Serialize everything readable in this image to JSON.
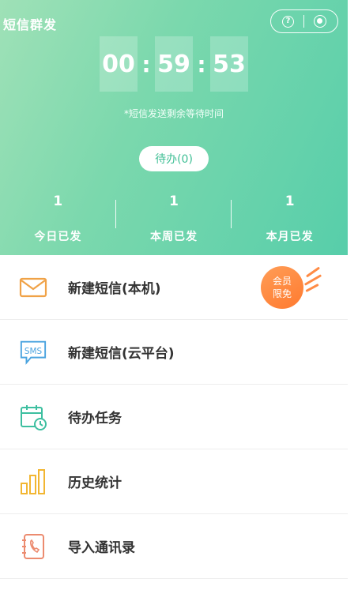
{
  "header": {
    "title": "短信群发"
  },
  "timer": {
    "hours": "00",
    "minutes": "59",
    "seconds": "53",
    "note": "*短信发送剩余等待时间"
  },
  "pending_button": "待办(0)",
  "stats": [
    {
      "value": "1",
      "label": "今日已发"
    },
    {
      "value": "1",
      "label": "本周已发"
    },
    {
      "value": "1",
      "label": "本月已发"
    }
  ],
  "vip_badge": {
    "line1": "会员",
    "line2": "限免"
  },
  "menu": [
    {
      "label": "新建短信(本机)",
      "icon": "envelope-icon"
    },
    {
      "label": "新建短信(云平台)",
      "icon": "sms-bubble-icon",
      "icon_text": "SMS"
    },
    {
      "label": "待办任务",
      "icon": "calendar-clock-icon"
    },
    {
      "label": "历史统计",
      "icon": "bar-chart-icon"
    },
    {
      "label": "导入通讯录",
      "icon": "phone-book-icon"
    }
  ],
  "colors": {
    "accent": "#57ceaa",
    "vip": "#ff7a2f"
  }
}
